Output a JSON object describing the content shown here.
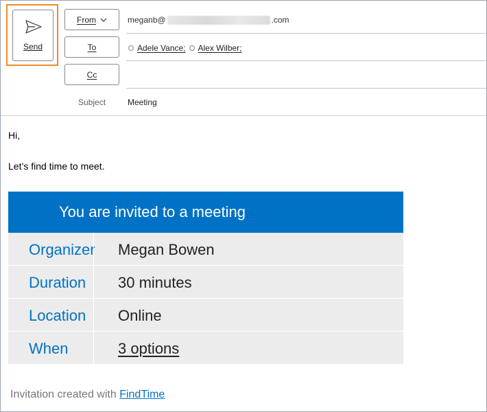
{
  "compose": {
    "send_label": "Send",
    "from": {
      "button_label": "From",
      "address_prefix": "meganb@",
      "address_suffix": ".com"
    },
    "to": {
      "button_label": "To",
      "recipients": [
        "Adele Vance;",
        "Alex Wilber;"
      ]
    },
    "cc": {
      "button_label": "Cc",
      "value": ""
    },
    "subject": {
      "label": "Subject",
      "value": "Meeting"
    }
  },
  "message": {
    "greeting": "Hi,",
    "line": "Let’s find time to meet.",
    "card": {
      "title": "You are invited to a meeting",
      "rows": [
        {
          "key": "Organizer",
          "value": "Megan Bowen"
        },
        {
          "key": "Duration",
          "value": "30 minutes"
        },
        {
          "key": "Location",
          "value": "Online"
        },
        {
          "key": "When",
          "value": "3 options"
        }
      ]
    },
    "footer": {
      "text": "Invitation created with",
      "link": "FindTime"
    }
  },
  "colors": {
    "accent": "#0072c6",
    "highlight": "#f08a24",
    "card_row_bg": "#ececec"
  }
}
